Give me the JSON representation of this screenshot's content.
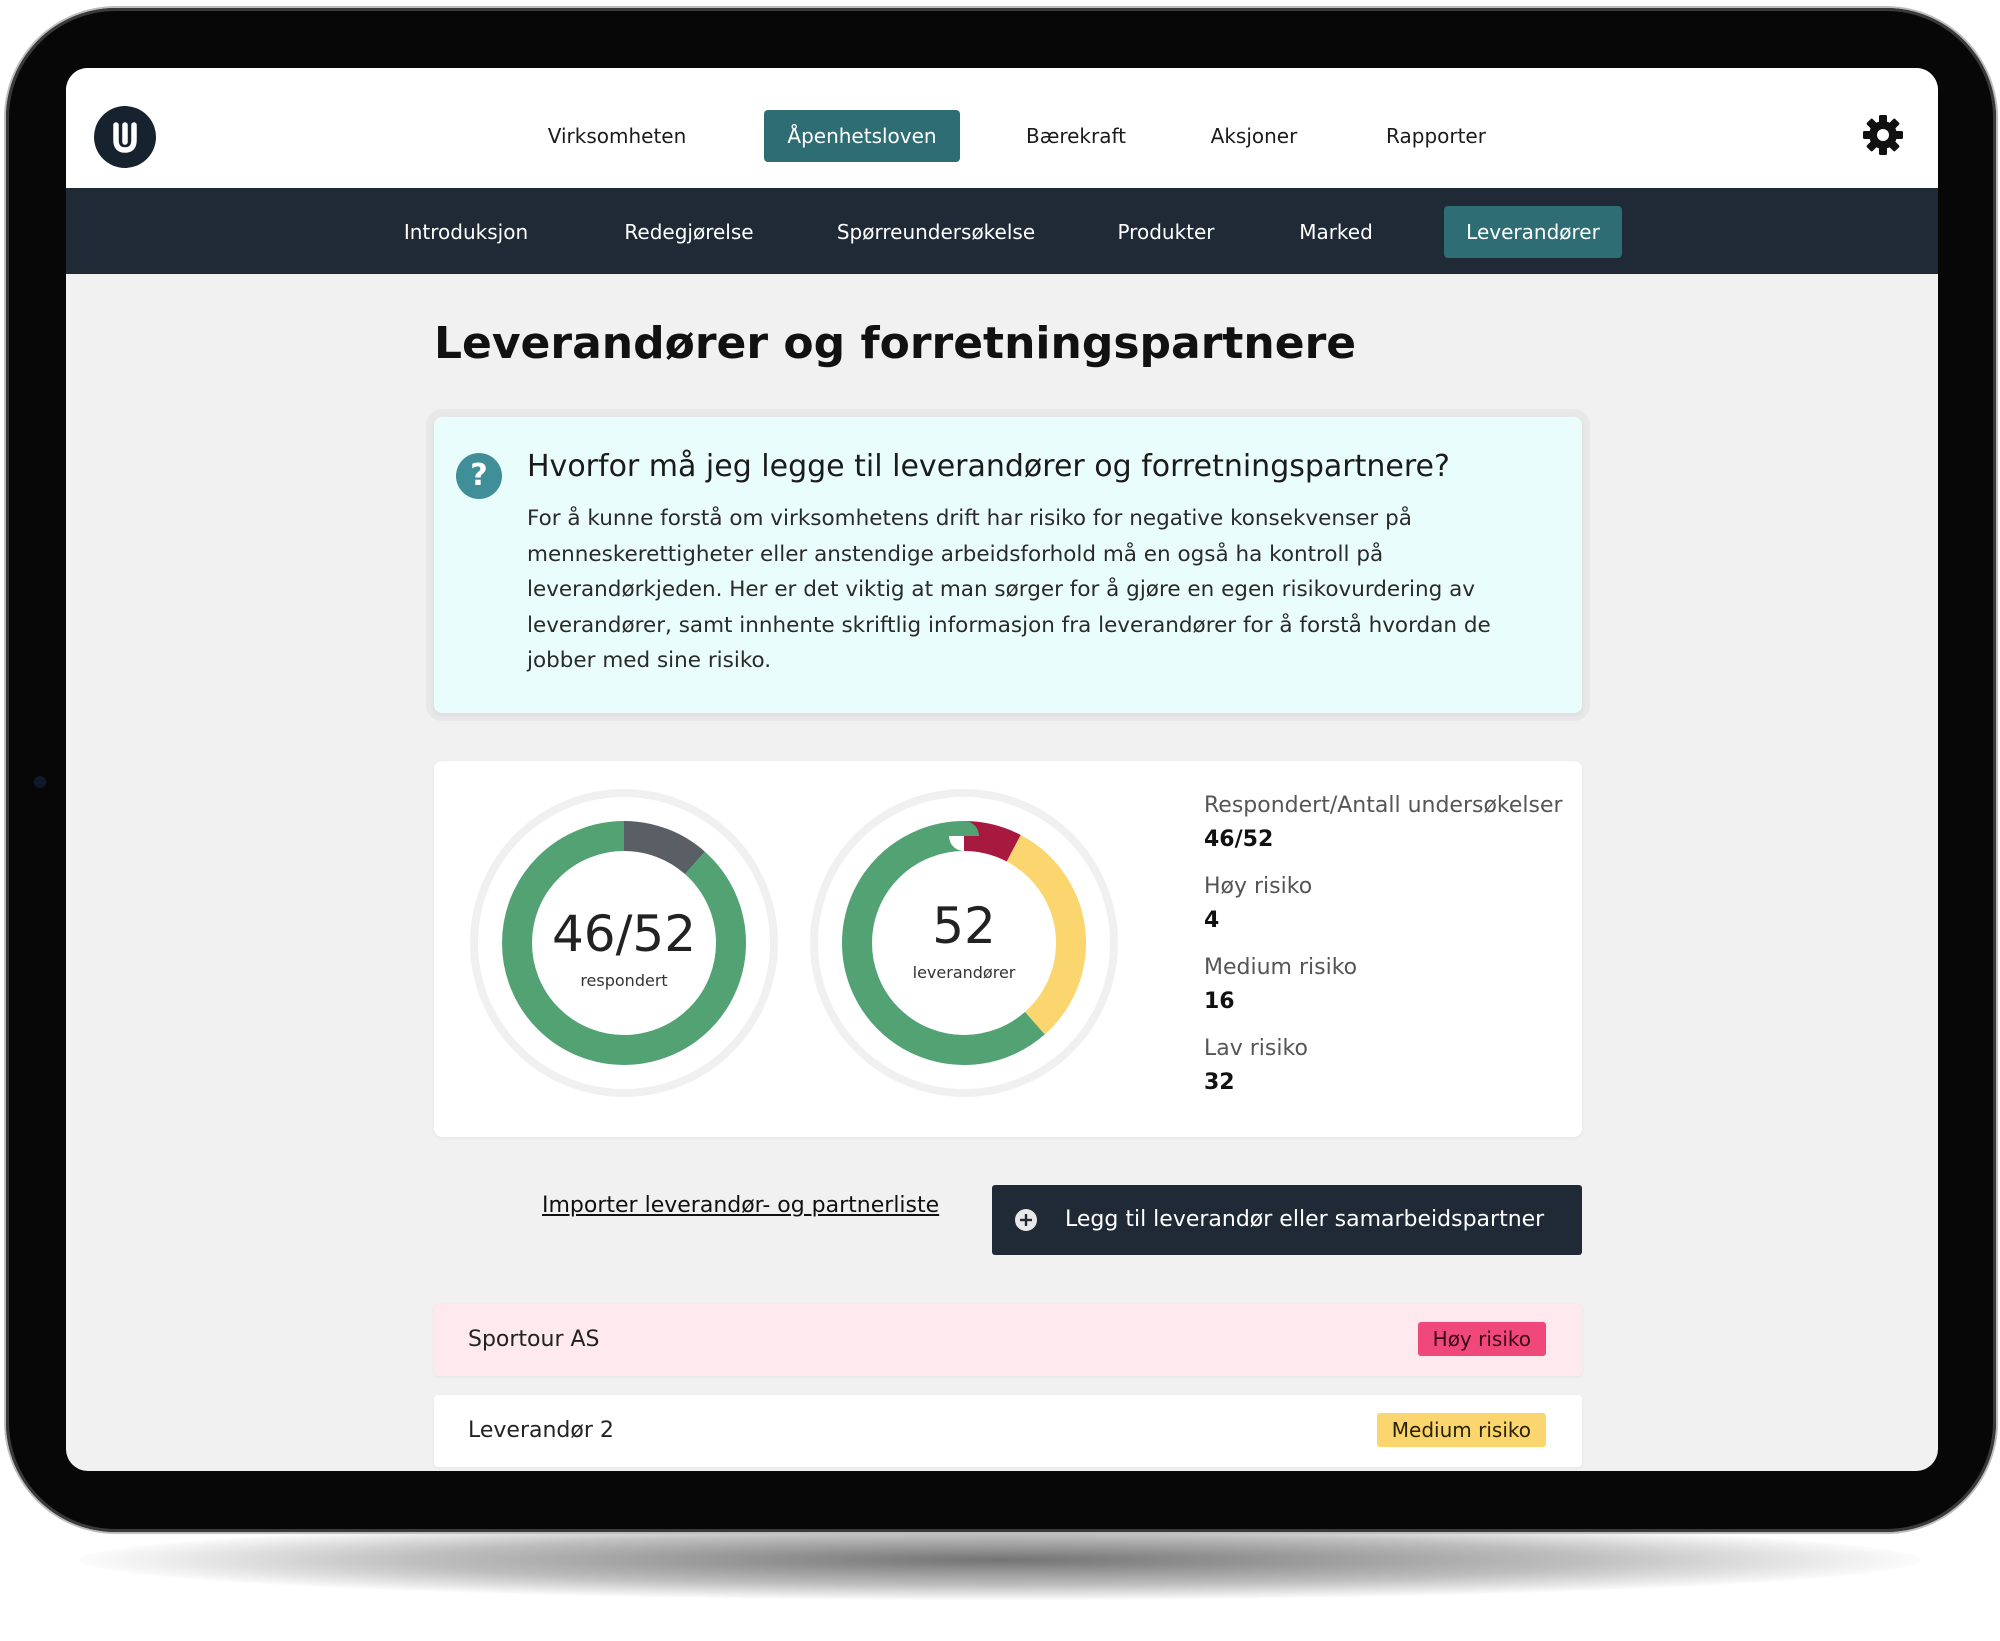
{
  "topnav": {
    "items": [
      {
        "label": "Virksomheten"
      },
      {
        "label": "Åpenhetsloven",
        "active": true
      },
      {
        "label": "Bærekraft"
      },
      {
        "label": "Aksjoner"
      },
      {
        "label": "Rapporter"
      }
    ],
    "logo_icon": "logo-icon",
    "settings_icon": "gear-icon"
  },
  "subnav": {
    "items": [
      {
        "label": "Introduksjon"
      },
      {
        "label": "Redegjørelse"
      },
      {
        "label": "Spørreundersøkelse"
      },
      {
        "label": "Produkter"
      },
      {
        "label": "Marked"
      },
      {
        "label": "Leverandører",
        "active": true
      }
    ]
  },
  "page": {
    "title": "Leverandører og forretningspartnere"
  },
  "info": {
    "icon": "question-icon",
    "title": "Hvorfor må jeg legge til leverandører og forretningspartnere?",
    "body": "For å kunne forstå om virksomhetens drift har risiko for negative konsekvenser på menneskerettigheter eller anstendige arbeidsforhold må en også ha kontroll på leverandørkjeden. Her er det viktig at man sørger for å gjøre en egen risikovurdering av leverandører, samt innhente skriftlig informasjon fra leverandører for å forstå hvordan de jobber med sine risiko."
  },
  "donut_responded": {
    "center_value": "46/52",
    "center_label": "respondert",
    "responded": 46,
    "total": 52,
    "colors": {
      "responded": "#52a274",
      "remaining": "#5a5f66"
    }
  },
  "donut_suppliers": {
    "center_value": "52",
    "center_label": "leverandører",
    "segments": [
      {
        "label": "Høy risiko",
        "value": 4,
        "color": "#a8193f"
      },
      {
        "label": "Medium risiko",
        "value": 16,
        "color": "#fbd56e"
      },
      {
        "label": "Lav risiko",
        "value": 32,
        "color": "#52a274"
      }
    ]
  },
  "stats": [
    {
      "label": "Respondert/Antall undersøkelser",
      "value": "46/52"
    },
    {
      "label": "Høy risiko",
      "value": "4"
    },
    {
      "label": "Medium risiko",
      "value": "16"
    },
    {
      "label": "Lav risiko",
      "value": "32"
    }
  ],
  "actions": {
    "import_label": "Importer leverandør- og partnerliste",
    "add_label": "Legg til leverandør eller samarbeidspartner",
    "add_icon": "plus-circle-icon"
  },
  "suppliers": [
    {
      "name": "Sportour AS",
      "risk": "Høy risiko",
      "row_bg": "#fde9ee",
      "badge_bg": "#f0487b",
      "badge_fg": "#3a0a18"
    },
    {
      "name": "Leverandør 2",
      "risk": "Medium risiko",
      "row_bg": "#ffffff",
      "badge_bg": "#fbd56e",
      "badge_fg": "#2a2200"
    }
  ]
}
